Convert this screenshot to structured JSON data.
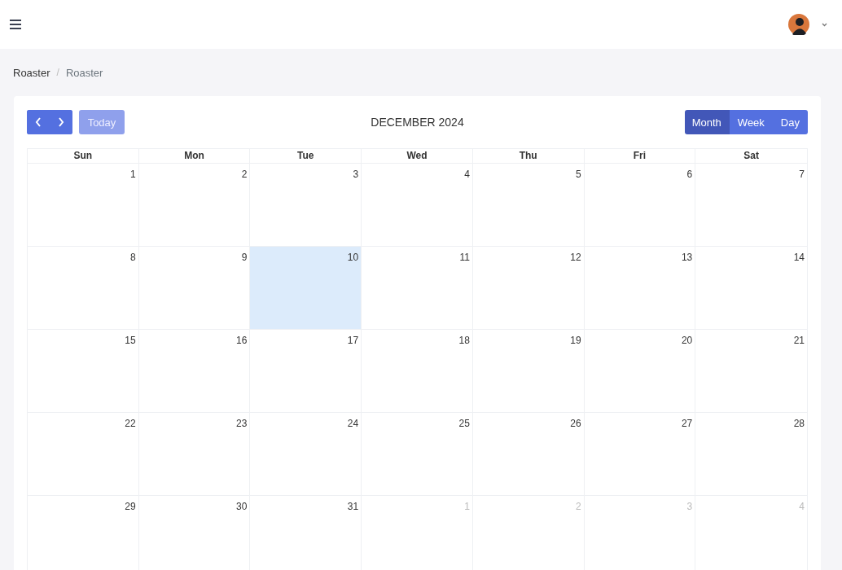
{
  "breadcrumb": [
    "Roaster",
    "Roaster"
  ],
  "breadcrumb_separator": "/",
  "toolbar": {
    "today": "Today",
    "today_disabled": true,
    "title": "DECEMBER 2024",
    "views": [
      {
        "label": "Month",
        "selected": true
      },
      {
        "label": "Week",
        "selected": false
      },
      {
        "label": "Day",
        "selected": false
      }
    ]
  },
  "weekdays": [
    "Sun",
    "Mon",
    "Tue",
    "Wed",
    "Thu",
    "Fri",
    "Sat"
  ],
  "weeks": [
    [
      {
        "day": "1",
        "other_month": false,
        "today": false
      },
      {
        "day": "2",
        "other_month": false,
        "today": false
      },
      {
        "day": "3",
        "other_month": false,
        "today": false
      },
      {
        "day": "4",
        "other_month": false,
        "today": false
      },
      {
        "day": "5",
        "other_month": false,
        "today": false
      },
      {
        "day": "6",
        "other_month": false,
        "today": false
      },
      {
        "day": "7",
        "other_month": false,
        "today": false
      }
    ],
    [
      {
        "day": "8",
        "other_month": false,
        "today": false
      },
      {
        "day": "9",
        "other_month": false,
        "today": false
      },
      {
        "day": "10",
        "other_month": false,
        "today": true
      },
      {
        "day": "11",
        "other_month": false,
        "today": false
      },
      {
        "day": "12",
        "other_month": false,
        "today": false
      },
      {
        "day": "13",
        "other_month": false,
        "today": false
      },
      {
        "day": "14",
        "other_month": false,
        "today": false
      }
    ],
    [
      {
        "day": "15",
        "other_month": false,
        "today": false
      },
      {
        "day": "16",
        "other_month": false,
        "today": false
      },
      {
        "day": "17",
        "other_month": false,
        "today": false
      },
      {
        "day": "18",
        "other_month": false,
        "today": false
      },
      {
        "day": "19",
        "other_month": false,
        "today": false
      },
      {
        "day": "20",
        "other_month": false,
        "today": false
      },
      {
        "day": "21",
        "other_month": false,
        "today": false
      }
    ],
    [
      {
        "day": "22",
        "other_month": false,
        "today": false
      },
      {
        "day": "23",
        "other_month": false,
        "today": false
      },
      {
        "day": "24",
        "other_month": false,
        "today": false
      },
      {
        "day": "25",
        "other_month": false,
        "today": false
      },
      {
        "day": "26",
        "other_month": false,
        "today": false
      },
      {
        "day": "27",
        "other_month": false,
        "today": false
      },
      {
        "day": "28",
        "other_month": false,
        "today": false
      }
    ],
    [
      {
        "day": "29",
        "other_month": false,
        "today": false
      },
      {
        "day": "30",
        "other_month": false,
        "today": false
      },
      {
        "day": "31",
        "other_month": false,
        "today": false
      },
      {
        "day": "1",
        "other_month": true,
        "today": false
      },
      {
        "day": "2",
        "other_month": true,
        "today": false
      },
      {
        "day": "3",
        "other_month": true,
        "today": false
      },
      {
        "day": "4",
        "other_month": true,
        "today": false
      }
    ]
  ]
}
